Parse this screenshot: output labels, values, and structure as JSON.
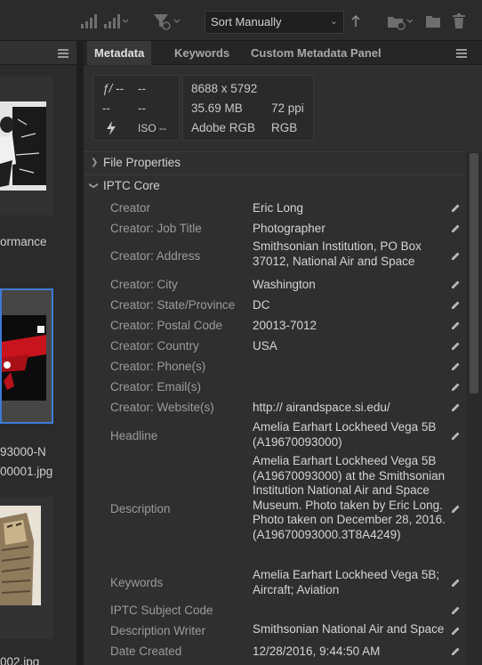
{
  "toolbar": {
    "sort_value": "Sort Manually"
  },
  "left_panel": {
    "items": [
      {
        "label": "ormance"
      },
      {
        "label": "93000-N"
      },
      {
        "label": "00001.jpg"
      },
      {
        "label": "002.jpg"
      }
    ]
  },
  "tabs": [
    {
      "label": "Metadata"
    },
    {
      "label": "Keywords"
    },
    {
      "label": "Custom Metadata Panel"
    }
  ],
  "camera": {
    "aperture": "ƒ/ --",
    "shutter": "--",
    "row2_a": "--",
    "row2_b": "--",
    "iso": "ISO --"
  },
  "image_info": {
    "dimensions": "8688 x 5792",
    "size": "35.69 MB",
    "ppi": "72 ppi",
    "profile": "Adobe RGB",
    "mode": "RGB"
  },
  "sections": {
    "file_properties": "File Properties",
    "iptc_core": "IPTC Core"
  },
  "fields": [
    {
      "label": "Creator",
      "value": "Eric Long"
    },
    {
      "label": "Creator: Job Title",
      "value": "Photographer"
    },
    {
      "label": "Creator: Address",
      "value": "Smithsonian Institution, PO Box 37012, National Air and Space"
    },
    {
      "label": "Creator: City",
      "value": "Washington"
    },
    {
      "label": "Creator: State/Province",
      "value": "DC"
    },
    {
      "label": "Creator: Postal Code",
      "value": "20013-7012"
    },
    {
      "label": "Creator: Country",
      "value": "USA"
    },
    {
      "label": "Creator: Phone(s)",
      "value": ""
    },
    {
      "label": "Creator: Email(s)",
      "value": ""
    },
    {
      "label": "Creator: Website(s)",
      "value": "http:// airandspace.si.edu/"
    },
    {
      "label": "Headline",
      "value": "Amelia Earhart Lockheed Vega 5B (A19670093000)"
    },
    {
      "label": "Description",
      "value": "Amelia Earhart Lockheed Vega 5B (A19670093000) at the Smithsonian Institution National Air and Space Museum. Photo taken by Eric Long. Photo taken on December 28, 2016. (A19670093000.3T8A4249)"
    },
    {
      "label": "Keywords",
      "value": "Amelia Earhart Lockheed Vega 5B; Aircraft; Aviation"
    },
    {
      "label": "IPTC Subject Code",
      "value": ""
    },
    {
      "label": "Description Writer",
      "value": "Smithsonian National Air and Space"
    },
    {
      "label": "Date Created",
      "value": "12/28/2016, 9:44:50 AM"
    }
  ]
}
